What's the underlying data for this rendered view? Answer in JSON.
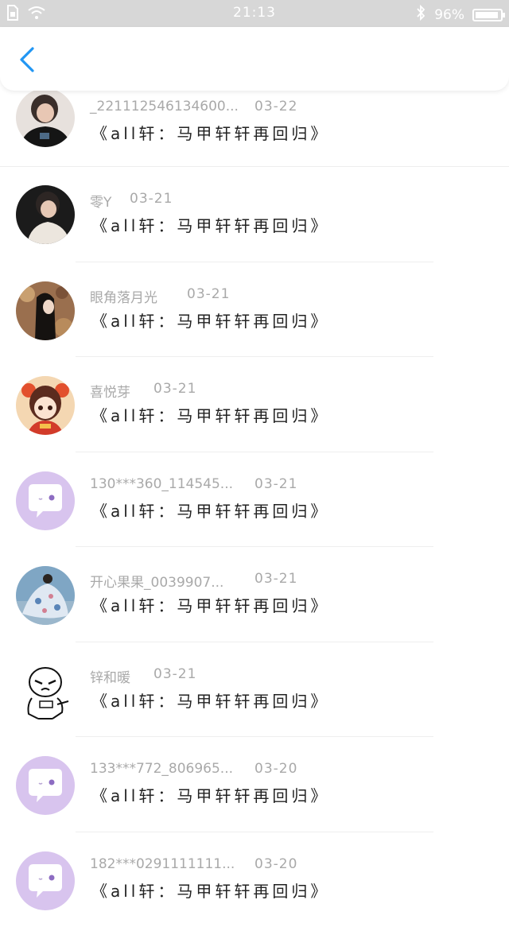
{
  "status_bar": {
    "time": "21:13",
    "battery": "96%"
  },
  "items": [
    {
      "name": "_221112546134600...",
      "date": "03-22",
      "message": "《all轩：马甲轩轩再回归》",
      "avatar": "photo-dark-shirt"
    },
    {
      "name": "零Y",
      "date": "03-21",
      "message": "《all轩：马甲轩轩再回归》",
      "avatar": "photo-boy"
    },
    {
      "name": "眼角落月光",
      "date": "03-21",
      "message": "《all轩：马甲轩轩再回归》",
      "avatar": "photo-girl-floral"
    },
    {
      "name": "喜悦芽",
      "date": "03-21",
      "message": "《all轩：马甲轩轩再回归》",
      "avatar": "anime-girl"
    },
    {
      "name": "130***360_114545...",
      "date": "03-21",
      "message": "《all轩：马甲轩轩再回归》",
      "avatar": "default-chat-icon"
    },
    {
      "name": "开心果果_0039907...",
      "date": "03-21",
      "message": "《all轩：马甲轩轩再回归》",
      "avatar": "photo-dress"
    },
    {
      "name": "锌和暖",
      "date": "03-21",
      "message": "《all轩：马甲轩轩再回归》",
      "avatar": "sketch-baby"
    },
    {
      "name": "133***772_806965...",
      "date": "03-20",
      "message": "《all轩：马甲轩轩再回归》",
      "avatar": "default-chat-icon"
    },
    {
      "name": "182***0291111111...",
      "date": "03-20",
      "message": "《all轩：马甲轩轩再回归》",
      "avatar": "default-chat-icon"
    }
  ],
  "colors": {
    "accent": "#2196f3",
    "status_bar_bg": "#d7d7d7",
    "default_avatar": "#d8c4ee"
  }
}
